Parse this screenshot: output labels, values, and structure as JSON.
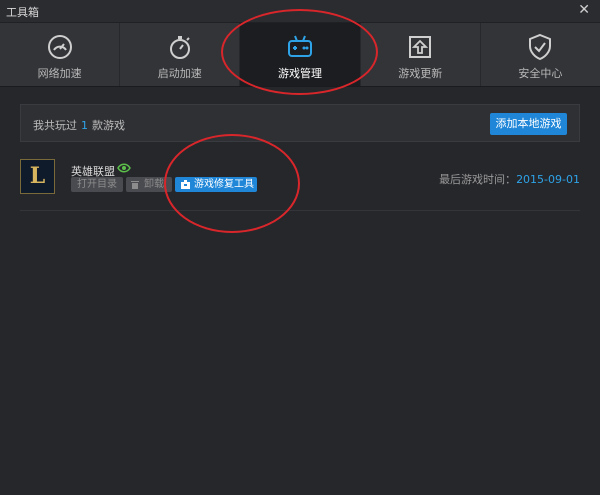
{
  "window": {
    "title": "工具箱",
    "close_glyph": "✕"
  },
  "tabs": [
    {
      "label": "网络加速",
      "icon": "speedometer-icon"
    },
    {
      "label": "启动加速",
      "icon": "stopwatch-icon"
    },
    {
      "label": "游戏管理",
      "icon": "gamepad-icon",
      "active": true
    },
    {
      "label": "游戏更新",
      "icon": "update-upload-icon"
    },
    {
      "label": "安全中心",
      "icon": "shield-check-icon"
    }
  ],
  "summary": {
    "prefix": "我共玩过",
    "count": "1",
    "suffix": "款游戏",
    "add_button": "添加本地游戏"
  },
  "game": {
    "name": "英雄联盟",
    "logo_letter": "L",
    "buttons": {
      "open_dir": "打开目录",
      "delete": "卸载",
      "repair": "游戏修复工具"
    },
    "last_played_label": "最后游戏时间：",
    "last_played_date": "2015-09-01"
  },
  "colors": {
    "accent": "#1f86d8",
    "highlight_ring": "#d8262b",
    "link": "#2ea3e8"
  }
}
